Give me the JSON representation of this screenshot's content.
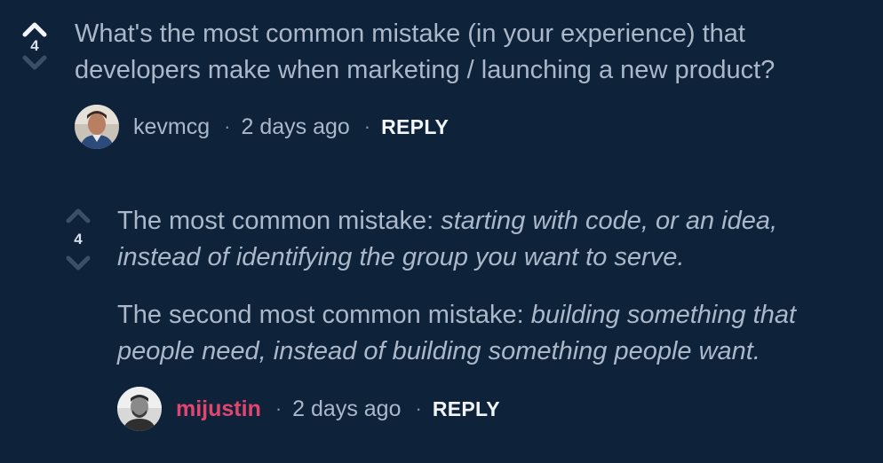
{
  "question": {
    "votes": "4",
    "text": "What's the most common mistake (in your experience) that developers make when marketing / launching a new product?",
    "author": "kevmcg",
    "time": "2 days ago",
    "reply_label": "REPLY",
    "upvote_icon": "chevron-up-icon",
    "downvote_icon": "chevron-down-icon"
  },
  "answer": {
    "votes": "4",
    "paragraphs": [
      {
        "plain": "The most common mistake: ",
        "emphasis": "starting with code, or an idea, instead of identifying the group you want to serve."
      },
      {
        "plain": "The second most common mistake: ",
        "emphasis": "building something that people need, instead of building something people want."
      }
    ],
    "author": "mijustin",
    "time": "2 days ago",
    "reply_label": "REPLY",
    "upvote_icon": "chevron-up-icon",
    "downvote_icon": "chevron-down-icon"
  },
  "separator": "·",
  "colors": {
    "background": "#0e223a",
    "body_text": "#aab8c9",
    "highlight_author": "#e2466f",
    "reply": "#f2f5f8",
    "vote_active": "#f2f5f8",
    "vote_inactive": "#3b4f66"
  }
}
